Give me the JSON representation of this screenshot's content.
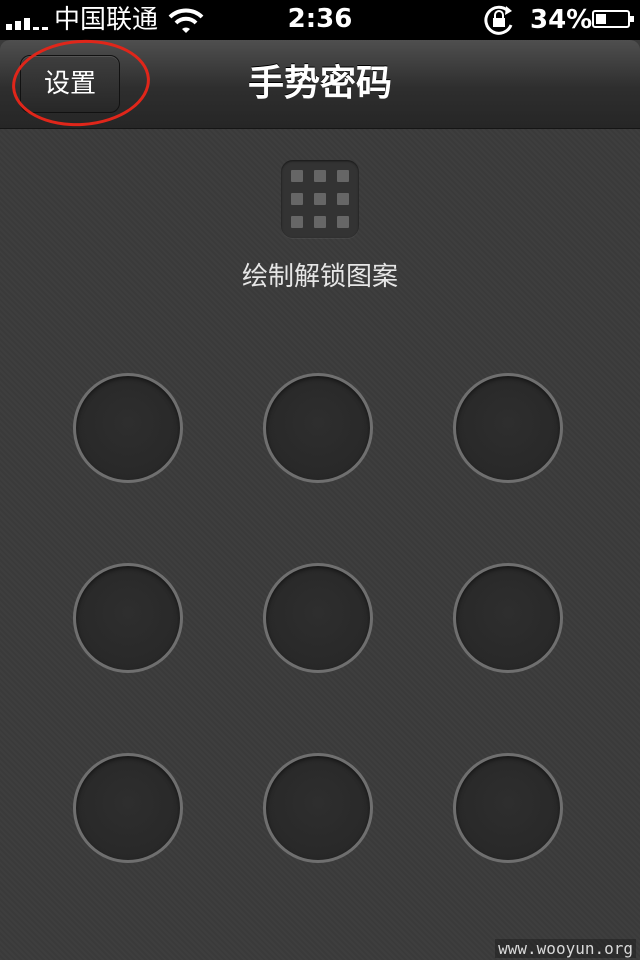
{
  "status_bar": {
    "carrier": "中国联通",
    "time": "2:36",
    "battery_percent": "34%",
    "battery_level": 0.34,
    "icons": [
      "signal-icon",
      "wifi-icon",
      "rotation-lock-icon",
      "battery-icon"
    ]
  },
  "nav": {
    "back_label": "设置",
    "title": "手势密码"
  },
  "content": {
    "prompt": "绘制解锁图案",
    "pattern_dots": 9
  },
  "watermark": "www.wooyun.org",
  "colors": {
    "annotation": "#e0261a",
    "background": "#3b3b3b",
    "dot_ring": "#6f6f6f"
  }
}
